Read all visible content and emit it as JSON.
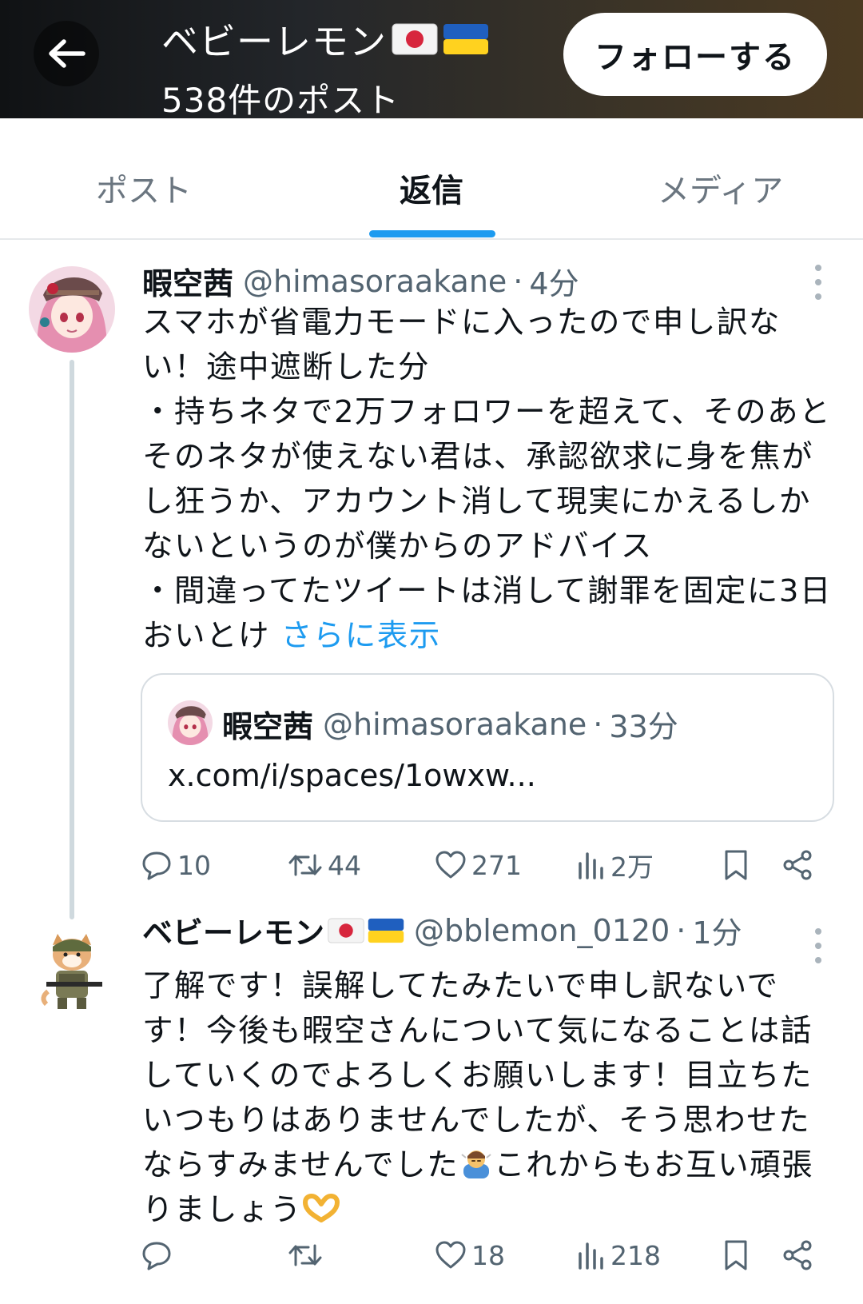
{
  "header": {
    "profile_name": "ベビーレモン",
    "post_count": "538件のポスト",
    "follow_label": "フォローする"
  },
  "tabs": [
    {
      "label": "ポスト",
      "active": false
    },
    {
      "label": "返信",
      "active": true
    },
    {
      "label": "メディア",
      "active": false
    }
  ],
  "posts": [
    {
      "author": "暇空茜",
      "handle": "@himasoraakane",
      "separator": "·",
      "time": "4分",
      "lines": [
        "スマホが省電力モードに入ったので申し訳な",
        "い！途中遮断した分",
        "・持ちネタで2万フォロワーを超えて、そのあと",
        "そのネタが使えない君は、承認欲求に身を焦が",
        "し狂うか、アカウント消して現実にかえるしか",
        "ないというのが僕からのアドバイス",
        "・間違ってたツイートは消して謝罪を固定に3日",
        "おいとけ"
      ],
      "show_more": "さらに表示",
      "quote": {
        "author": "暇空茜",
        "handle": "@himasoraakane",
        "separator": "·",
        "time": "33分",
        "text": "x.com/i/spaces/1owxw..."
      },
      "stats": {
        "replies": "10",
        "reposts": "44",
        "likes": "271",
        "views": "2万"
      }
    },
    {
      "author": "ベビーレモン",
      "handle": "@bblemon_0120",
      "separator": "·",
      "time": "1分",
      "lines": [
        "了解です！誤解してたみたいで申し訳ないで",
        "す！今後も暇空さんについて気になることは話",
        "していくのでよろしくお願いします！目立ちた",
        "いつもりはありませんでしたが、そう思わせた",
        "ならすみませんでした",
        "これからもお互い頑張",
        "りましょう"
      ],
      "stats": {
        "replies": "",
        "reposts": "",
        "likes": "18",
        "views": "218"
      }
    }
  ],
  "icons": {
    "back": "arrow-left-icon",
    "reply": "reply-icon",
    "repost": "repost-icon",
    "like": "heart-icon",
    "views": "views-icon",
    "bookmark": "bookmark-icon",
    "share": "share-icon"
  },
  "colors": {
    "accent": "#1d9bf0",
    "muted": "#536471",
    "text": "#0f1419"
  }
}
